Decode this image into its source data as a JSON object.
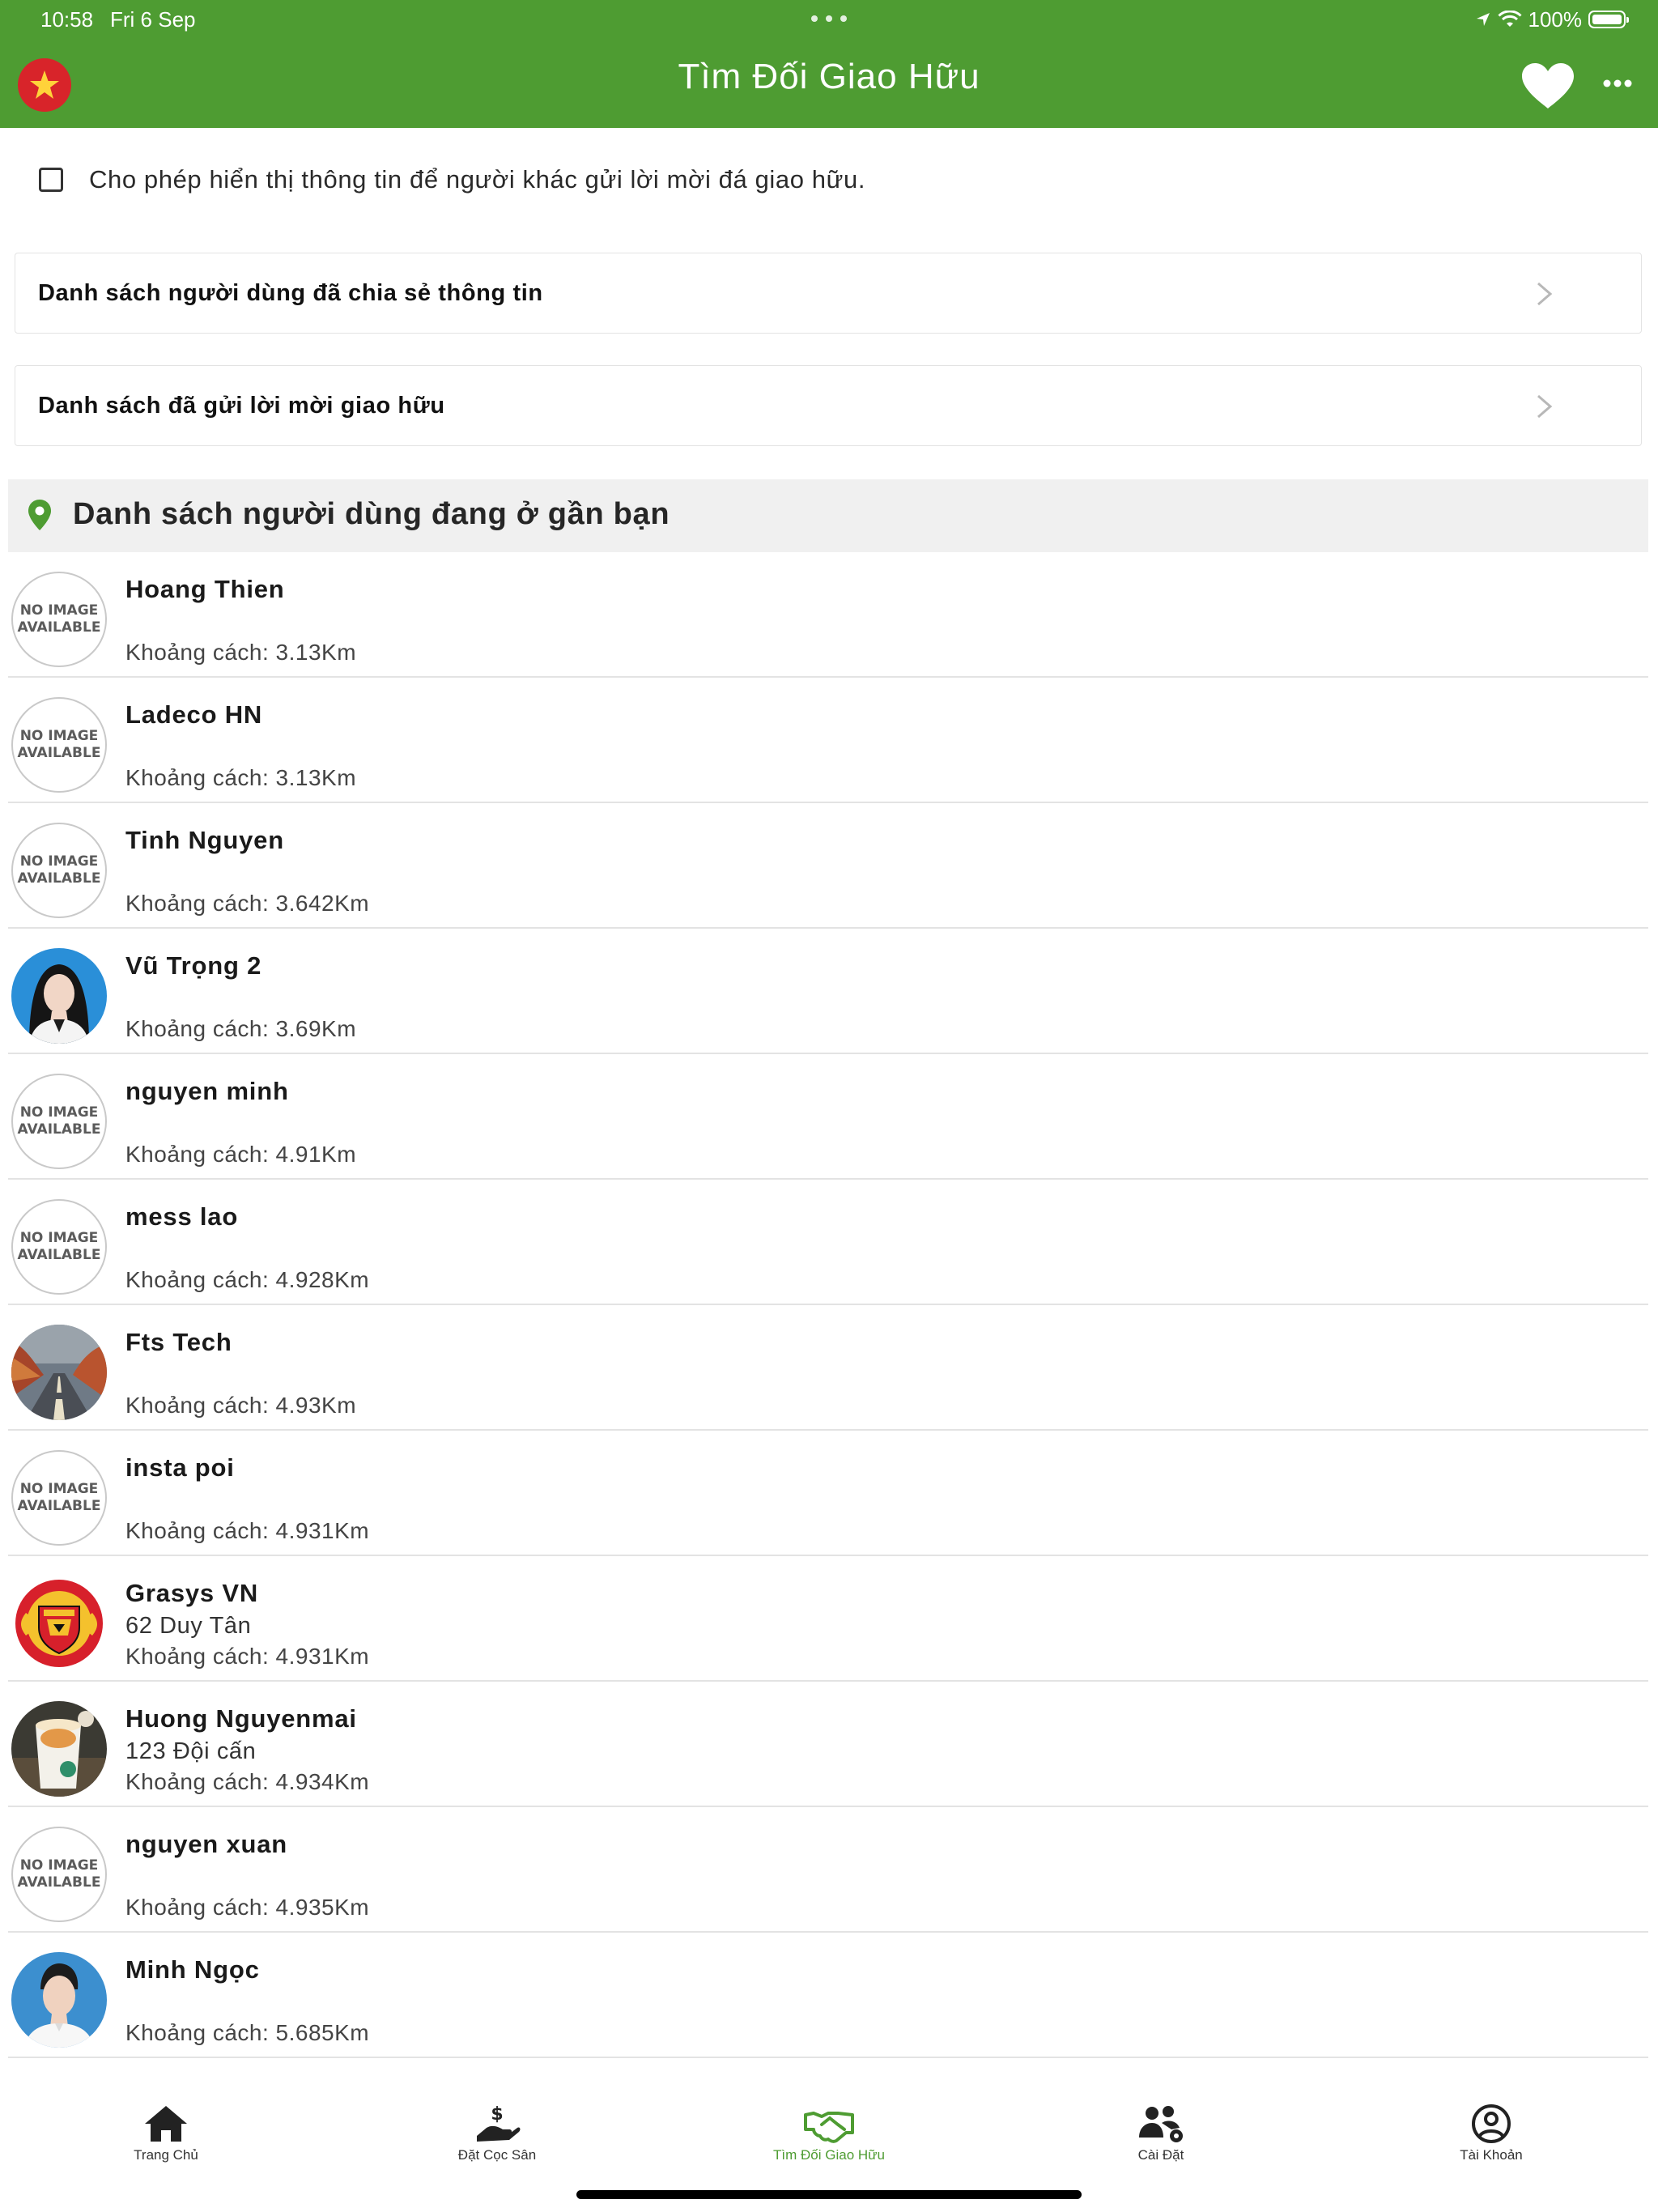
{
  "status_bar": {
    "time": "10:58",
    "date": "Fri 6 Sep",
    "battery": "100%"
  },
  "header": {
    "title": "Tìm Đối Giao Hữu"
  },
  "consent": {
    "label": "Cho phép hiển thị thông tin để người khác gửi lời mời đá giao hữu.",
    "checked": false
  },
  "links": [
    {
      "label": "Danh sách người dùng đã chia sẻ thông tin"
    },
    {
      "label": "Danh sách đã gửi lời mời giao hữu"
    }
  ],
  "nearby": {
    "title": "Danh sách người dùng đang ở gần bạn",
    "no_image_text": "NO IMAGE\nAVAILABLE",
    "users": [
      {
        "name": "Hoang Thien",
        "address": "",
        "distance": "Khoảng cách: 3.13Km",
        "avatar": "no-image"
      },
      {
        "name": "Ladeco HN",
        "address": "",
        "distance": "Khoảng cách: 3.13Km",
        "avatar": "no-image"
      },
      {
        "name": "Tinh Nguyen",
        "address": "",
        "distance": "Khoảng cách: 3.642Km",
        "avatar": "no-image"
      },
      {
        "name": "Vũ Trọng 2",
        "address": "",
        "distance": "Khoảng cách: 3.69Km",
        "avatar": "portrait-woman"
      },
      {
        "name": "nguyen minh",
        "address": "",
        "distance": "Khoảng cách: 4.91Km",
        "avatar": "no-image"
      },
      {
        "name": "mess lao",
        "address": "",
        "distance": "Khoảng cách: 4.928Km",
        "avatar": "no-image"
      },
      {
        "name": "Fts Tech",
        "address": "",
        "distance": "Khoảng cách: 4.93Km",
        "avatar": "road-photo"
      },
      {
        "name": "insta poi",
        "address": "",
        "distance": "Khoảng cách: 4.931Km",
        "avatar": "no-image"
      },
      {
        "name": "Grasys VN",
        "address": "62 Duy Tân",
        "distance": "Khoảng cách: 4.931Km",
        "avatar": "manchester-united-logo"
      },
      {
        "name": "Huong Nguyenmai",
        "address": "123 Đội cấn",
        "distance": "Khoảng cách: 4.934Km",
        "avatar": "coffee-photo"
      },
      {
        "name": "nguyen xuan",
        "address": "",
        "distance": "Khoảng cách: 4.935Km",
        "avatar": "no-image"
      },
      {
        "name": "Minh Ngọc",
        "address": "",
        "distance": "Khoảng cách: 5.685Km",
        "avatar": "portrait-man"
      }
    ]
  },
  "tabs": [
    {
      "label": "Trang Chủ",
      "icon": "home-icon",
      "active": false
    },
    {
      "label": "Đặt Cọc Sân",
      "icon": "deposit-icon",
      "active": false
    },
    {
      "label": "Tìm Đối Giao Hữu",
      "icon": "handshake-icon",
      "active": true
    },
    {
      "label": "Cài Đặt",
      "icon": "team-settings-icon",
      "active": false
    },
    {
      "label": "Tài Khoản",
      "icon": "account-icon",
      "active": false
    }
  ],
  "colors": {
    "brand_green": "#4e9c32",
    "flag_red": "#d8242a",
    "flag_star": "#ffd23a"
  }
}
